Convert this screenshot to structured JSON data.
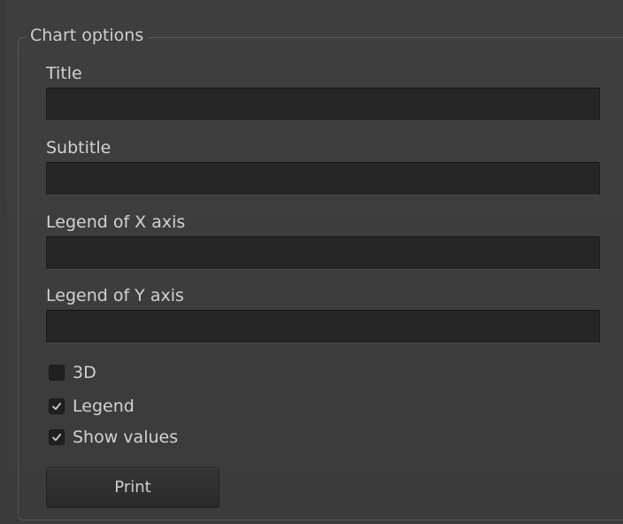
{
  "group": {
    "title": "Chart options"
  },
  "fields": {
    "title": {
      "label": "Title",
      "value": ""
    },
    "subtitle": {
      "label": "Subtitle",
      "value": ""
    },
    "x_axis": {
      "label": "Legend of X axis",
      "value": ""
    },
    "y_axis": {
      "label": "Legend of Y axis",
      "value": ""
    }
  },
  "options": {
    "three_d": {
      "label": "3D",
      "checked": false
    },
    "legend": {
      "label": "Legend",
      "checked": true
    },
    "show_values": {
      "label": "Show values",
      "checked": true
    }
  },
  "actions": {
    "print_label": "Print"
  },
  "colors": {
    "background": "#3e3e3e",
    "input_background": "#262626",
    "text": "#d2d2d2",
    "checkmark": "#cfcfcf"
  },
  "icons": {
    "checkmark": "checkmark-icon"
  }
}
